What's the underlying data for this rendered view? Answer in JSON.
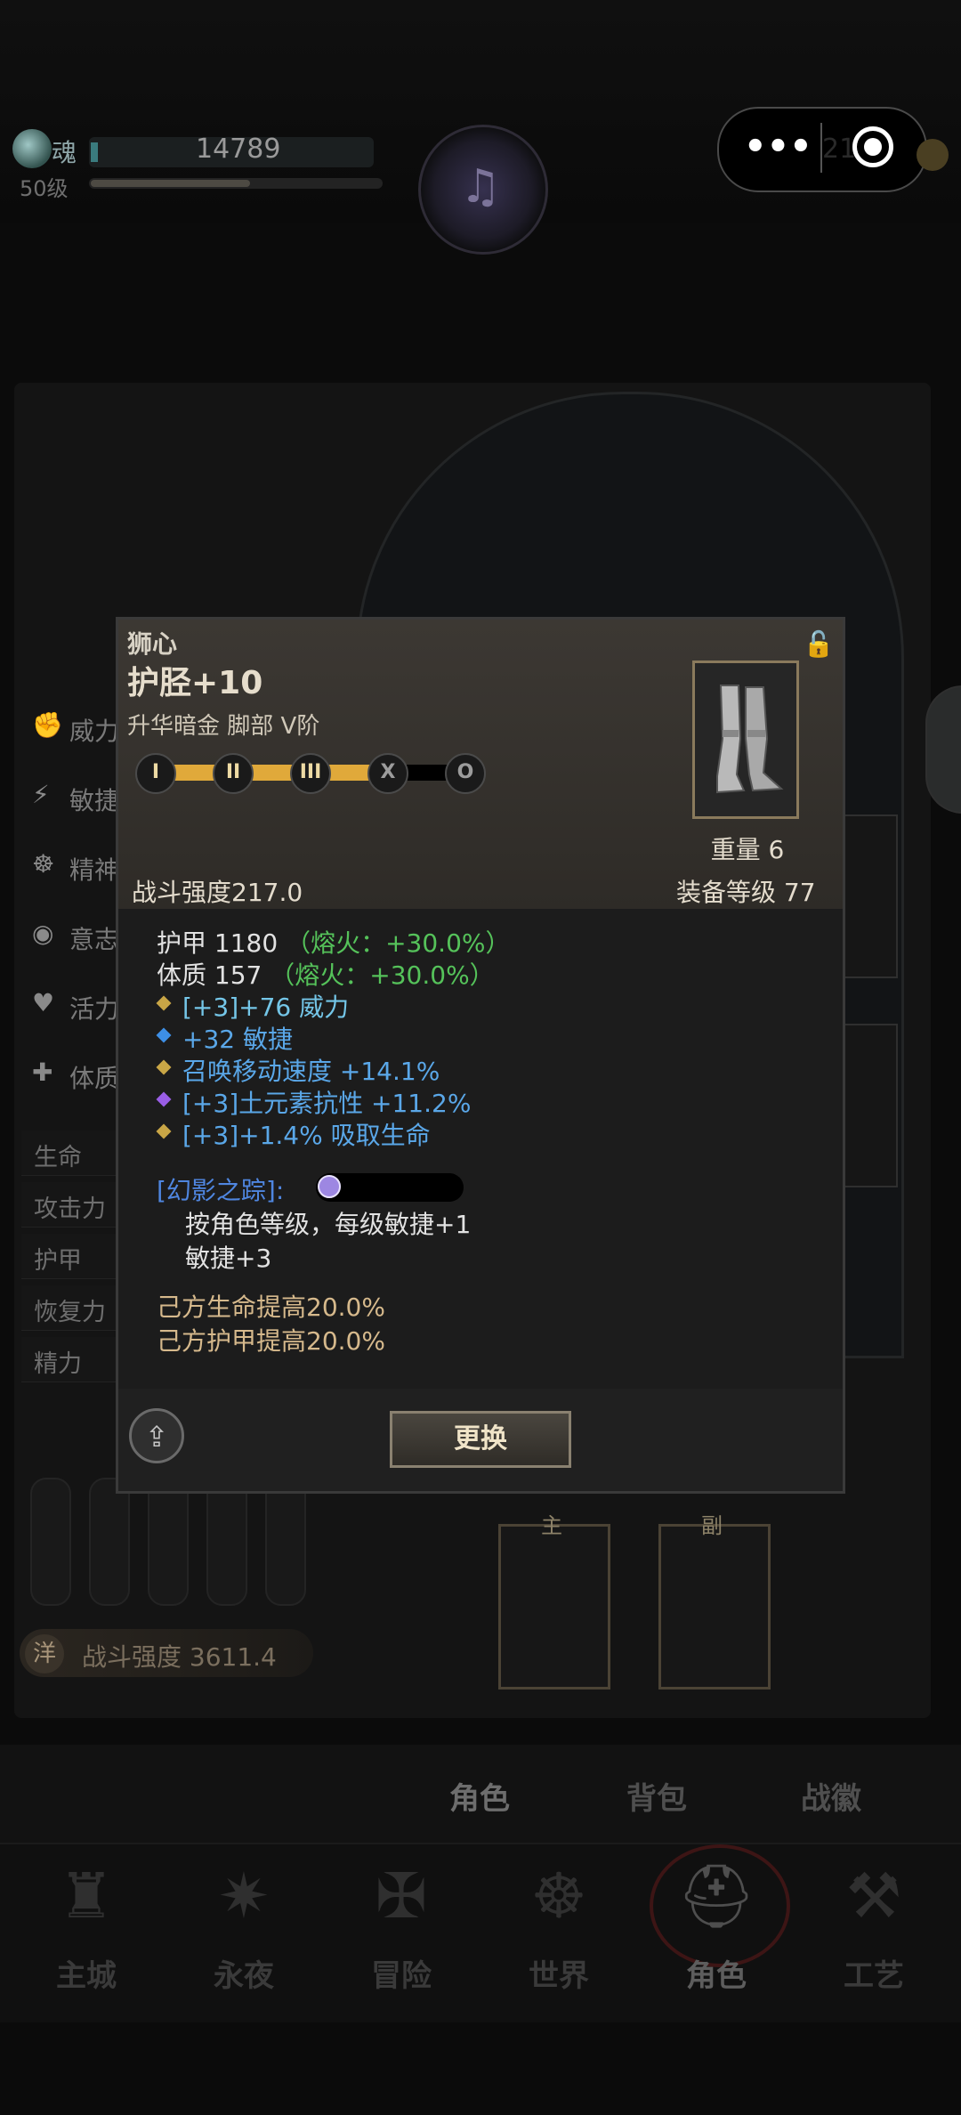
{
  "hud": {
    "soul_label": "魂",
    "soul_value": "14789",
    "level": "50级",
    "capsule_number": "21",
    "xp_progress": 0.55
  },
  "left_stats": [
    {
      "icon": "power-icon",
      "label": "威力"
    },
    {
      "icon": "agility-icon",
      "label": "敏捷"
    },
    {
      "icon": "spirit-icon",
      "label": "精神"
    },
    {
      "icon": "will-icon",
      "label": "意志"
    },
    {
      "icon": "vitality-icon",
      "label": "活力"
    },
    {
      "icon": "constitution-icon",
      "label": "体质"
    }
  ],
  "sub_stats": [
    "生命",
    "攻击力",
    "护甲",
    "恢复力",
    "精力"
  ],
  "combat_power_footer": {
    "badge": "洋",
    "text": "战斗强度 3611.4"
  },
  "weapon_tags": {
    "main": "主",
    "off": "副"
  },
  "item": {
    "name": "狮心",
    "type": "护胫+10",
    "tags": "升华暗金  脚部  V阶",
    "tiers": [
      "I",
      "II",
      "III",
      "X",
      "O"
    ],
    "tier_active_count": 3,
    "weight": "重量 6",
    "combat_strength": "战斗强度217.0",
    "equip_level": "装备等级 77",
    "base_stats": [
      {
        "text": "护甲  1180",
        "bonus": "（熔火：+30.0%）"
      },
      {
        "text": "体质  157",
        "bonus": "（熔火：+30.0%）"
      }
    ],
    "affixes": [
      {
        "text": "[+3]+76 威力",
        "color": "#74c6e8",
        "bullet": "#c9a646"
      },
      {
        "text": "+32 敏捷",
        "color": "#5aa7e8",
        "bullet": "#3d8fe6"
      },
      {
        "text": "召唤移动速度 +14.1%",
        "color": "#5aa7e8",
        "bullet": "#c9a646"
      },
      {
        "text": "[+3]土元素抗性 +11.2%",
        "color": "#5aa7e8",
        "bullet": "#9a5ee6"
      },
      {
        "text": "[+3]+1.4% 吸取生命",
        "color": "#5aa7e8",
        "bullet": "#c9a646"
      }
    ],
    "set_name": "[幻影之踪]:",
    "set_lines": [
      "按角色等级，每级敏捷+1",
      "敏捷+3"
    ],
    "bonuses": [
      "己方生命提高20.0%",
      "己方护甲提高20.0%"
    ],
    "swap_label": "更换"
  },
  "subtabs": [
    "角色",
    "背包",
    "战徽"
  ],
  "nav": [
    {
      "label": "主城",
      "icon": "castle-icon"
    },
    {
      "label": "永夜",
      "icon": "eternal-night-icon"
    },
    {
      "label": "冒险",
      "icon": "adventure-icon"
    },
    {
      "label": "世界",
      "icon": "world-icon"
    },
    {
      "label": "角色",
      "icon": "helmet-icon"
    },
    {
      "label": "工艺",
      "icon": "anvil-icon"
    }
  ]
}
